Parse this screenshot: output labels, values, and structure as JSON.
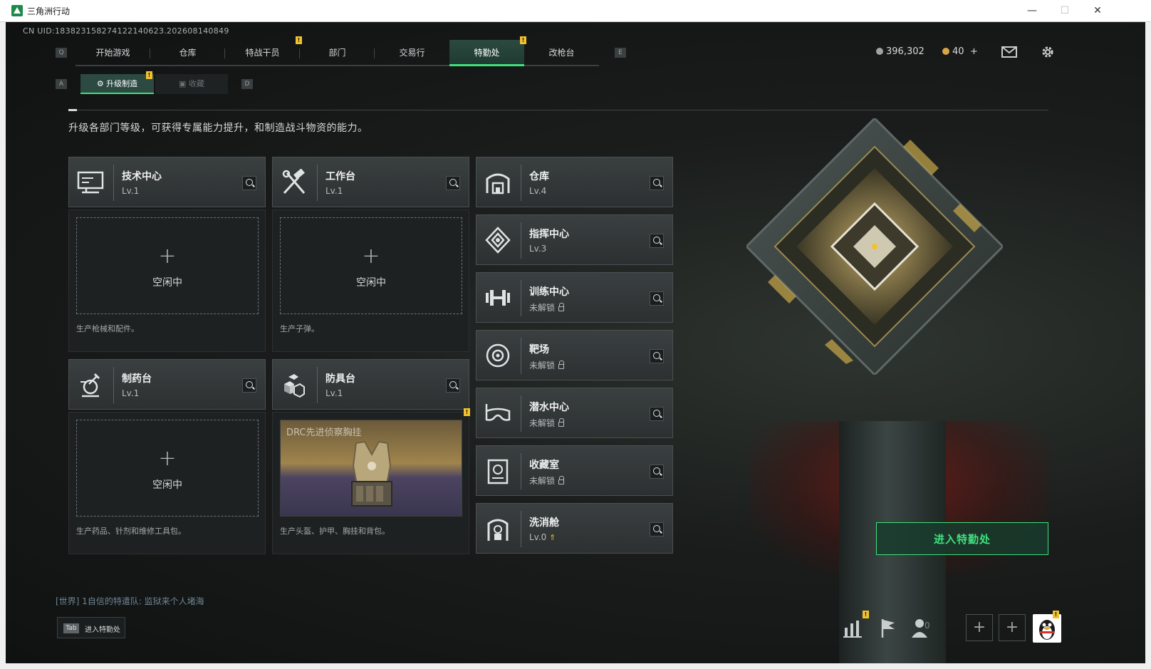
{
  "window": {
    "title": "三角洲行动",
    "minimize": "—",
    "maximize": "☐",
    "close": "✕"
  },
  "uid": "CN UID:1838231582741221406​23.202608140849",
  "nav": {
    "left_key": "Q",
    "right_key": "E",
    "tabs": [
      {
        "label": "开始游戏",
        "active": false,
        "alert": false
      },
      {
        "label": "仓库",
        "active": false,
        "alert": false
      },
      {
        "label": "特战干员",
        "active": false,
        "alert": true
      },
      {
        "label": "部门",
        "active": false,
        "alert": false
      },
      {
        "label": "交易行",
        "active": false,
        "alert": false
      },
      {
        "label": "特勤处",
        "active": true,
        "alert": true
      },
      {
        "label": "改枪台",
        "active": false,
        "alert": false
      }
    ],
    "alert_mark": "!"
  },
  "subnav": {
    "left_key": "A",
    "right_key": "D",
    "tabs": [
      {
        "label": "升级制造",
        "active": true
      },
      {
        "label": "收藏",
        "active": false
      }
    ]
  },
  "resources": {
    "silver": "396,302",
    "gold": "40",
    "gold_add": "+"
  },
  "description": "升级各部门等级，可获得专属能力提升，和制造战斗物资的能力。",
  "production": [
    {
      "name": "技术中心",
      "level": "Lv.1",
      "icon": "computer-icon",
      "slot_plus": "+",
      "slot_status": "空闲中",
      "caption": "生产枪械和配件。"
    },
    {
      "name": "工作台",
      "level": "Lv.1",
      "icon": "tools-icon",
      "slot_plus": "+",
      "slot_status": "空闲中",
      "caption": "生产子弹。"
    },
    {
      "name": "制药台",
      "level": "Lv.1",
      "icon": "pharmacy-icon",
      "slot_plus": "+",
      "slot_status": "空闲中",
      "caption": "生产药品、针剂和维修工具包。"
    },
    {
      "name": "防具台",
      "level": "Lv.1",
      "icon": "armor-icon",
      "item_name": "DRC先进侦察胸挂",
      "caption": "生产头盔、护甲、胸挂和背包。"
    }
  ],
  "departments": [
    {
      "name": "仓库",
      "level": "Lv.4",
      "icon": "warehouse-icon",
      "locked": false
    },
    {
      "name": "指挥中心",
      "level": "Lv.3",
      "icon": "command-icon",
      "locked": false
    },
    {
      "name": "训练中心",
      "level": "未解锁",
      "icon": "dumbbell-icon",
      "locked": true
    },
    {
      "name": "靶场",
      "level": "未解锁",
      "icon": "target-icon",
      "locked": true
    },
    {
      "name": "潜水中心",
      "level": "未解锁",
      "icon": "diving-mask-icon",
      "locked": true
    },
    {
      "name": "收藏室",
      "level": "未解锁",
      "icon": "collection-icon",
      "locked": true
    },
    {
      "name": "洗消舱",
      "level": "Lv.0",
      "icon": "decon-icon",
      "locked": false,
      "upgrade": true
    }
  ],
  "enter_button": "进入特勤处",
  "chat": "[世界] 1自信的特遣队: 监狱来个人堵海",
  "tab_hint": {
    "key": "Tab",
    "label": "进入特勤处"
  },
  "friends_count": "0",
  "add": "+",
  "colors": {
    "accent": "#3fe07d",
    "alert": "#f2c12e",
    "card": "#3a3f40"
  }
}
